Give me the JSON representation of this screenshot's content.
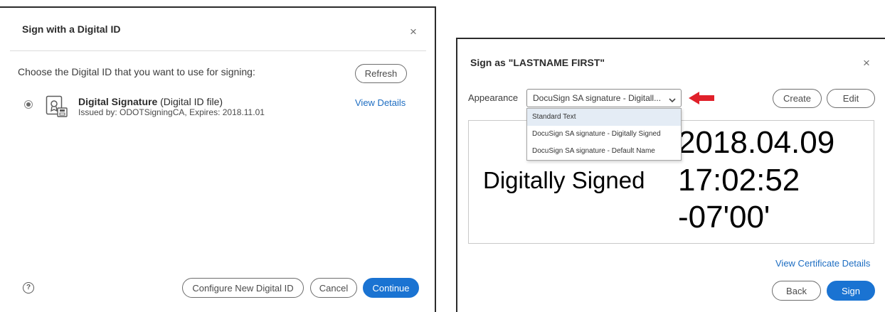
{
  "dialog1": {
    "title": "Sign with a Digital ID",
    "close": "×",
    "prompt": "Choose the Digital ID that you want to use for signing:",
    "refresh_label": "Refresh",
    "id_entry": {
      "name": "Digital Signature",
      "type": "(Digital ID file)",
      "issued": "Issued by: ODOTSigningCA, Expires: 2018.11.01",
      "view_details": "View Details",
      "selected": true
    },
    "help": "?",
    "configure_label": "Configure New Digital ID",
    "cancel_label": "Cancel",
    "continue_label": "Continue"
  },
  "dialog2": {
    "title_prefix": "Sign as",
    "title_name": "\"LASTNAME FIRST\"",
    "close": "×",
    "appearance_label": "Appearance",
    "appearance_value": "DocuSign SA signature - Digitall...",
    "dropdown_options": [
      "Standard Text",
      "DocuSign SA signature - Digitally Signed",
      "DocuSign SA signature - Default Name"
    ],
    "create_label": "Create",
    "edit_label": "Edit",
    "preview": {
      "left_text": "Digitally Signed",
      "date": "2018.04.09",
      "time": "17:02:52",
      "tz": "-07'00'"
    },
    "view_cert_label": "View Certificate Details",
    "back_label": "Back",
    "sign_label": "Sign"
  },
  "colors": {
    "primary": "#1a73d2",
    "link": "#1d6dc2",
    "arrow": "#e0202a"
  }
}
